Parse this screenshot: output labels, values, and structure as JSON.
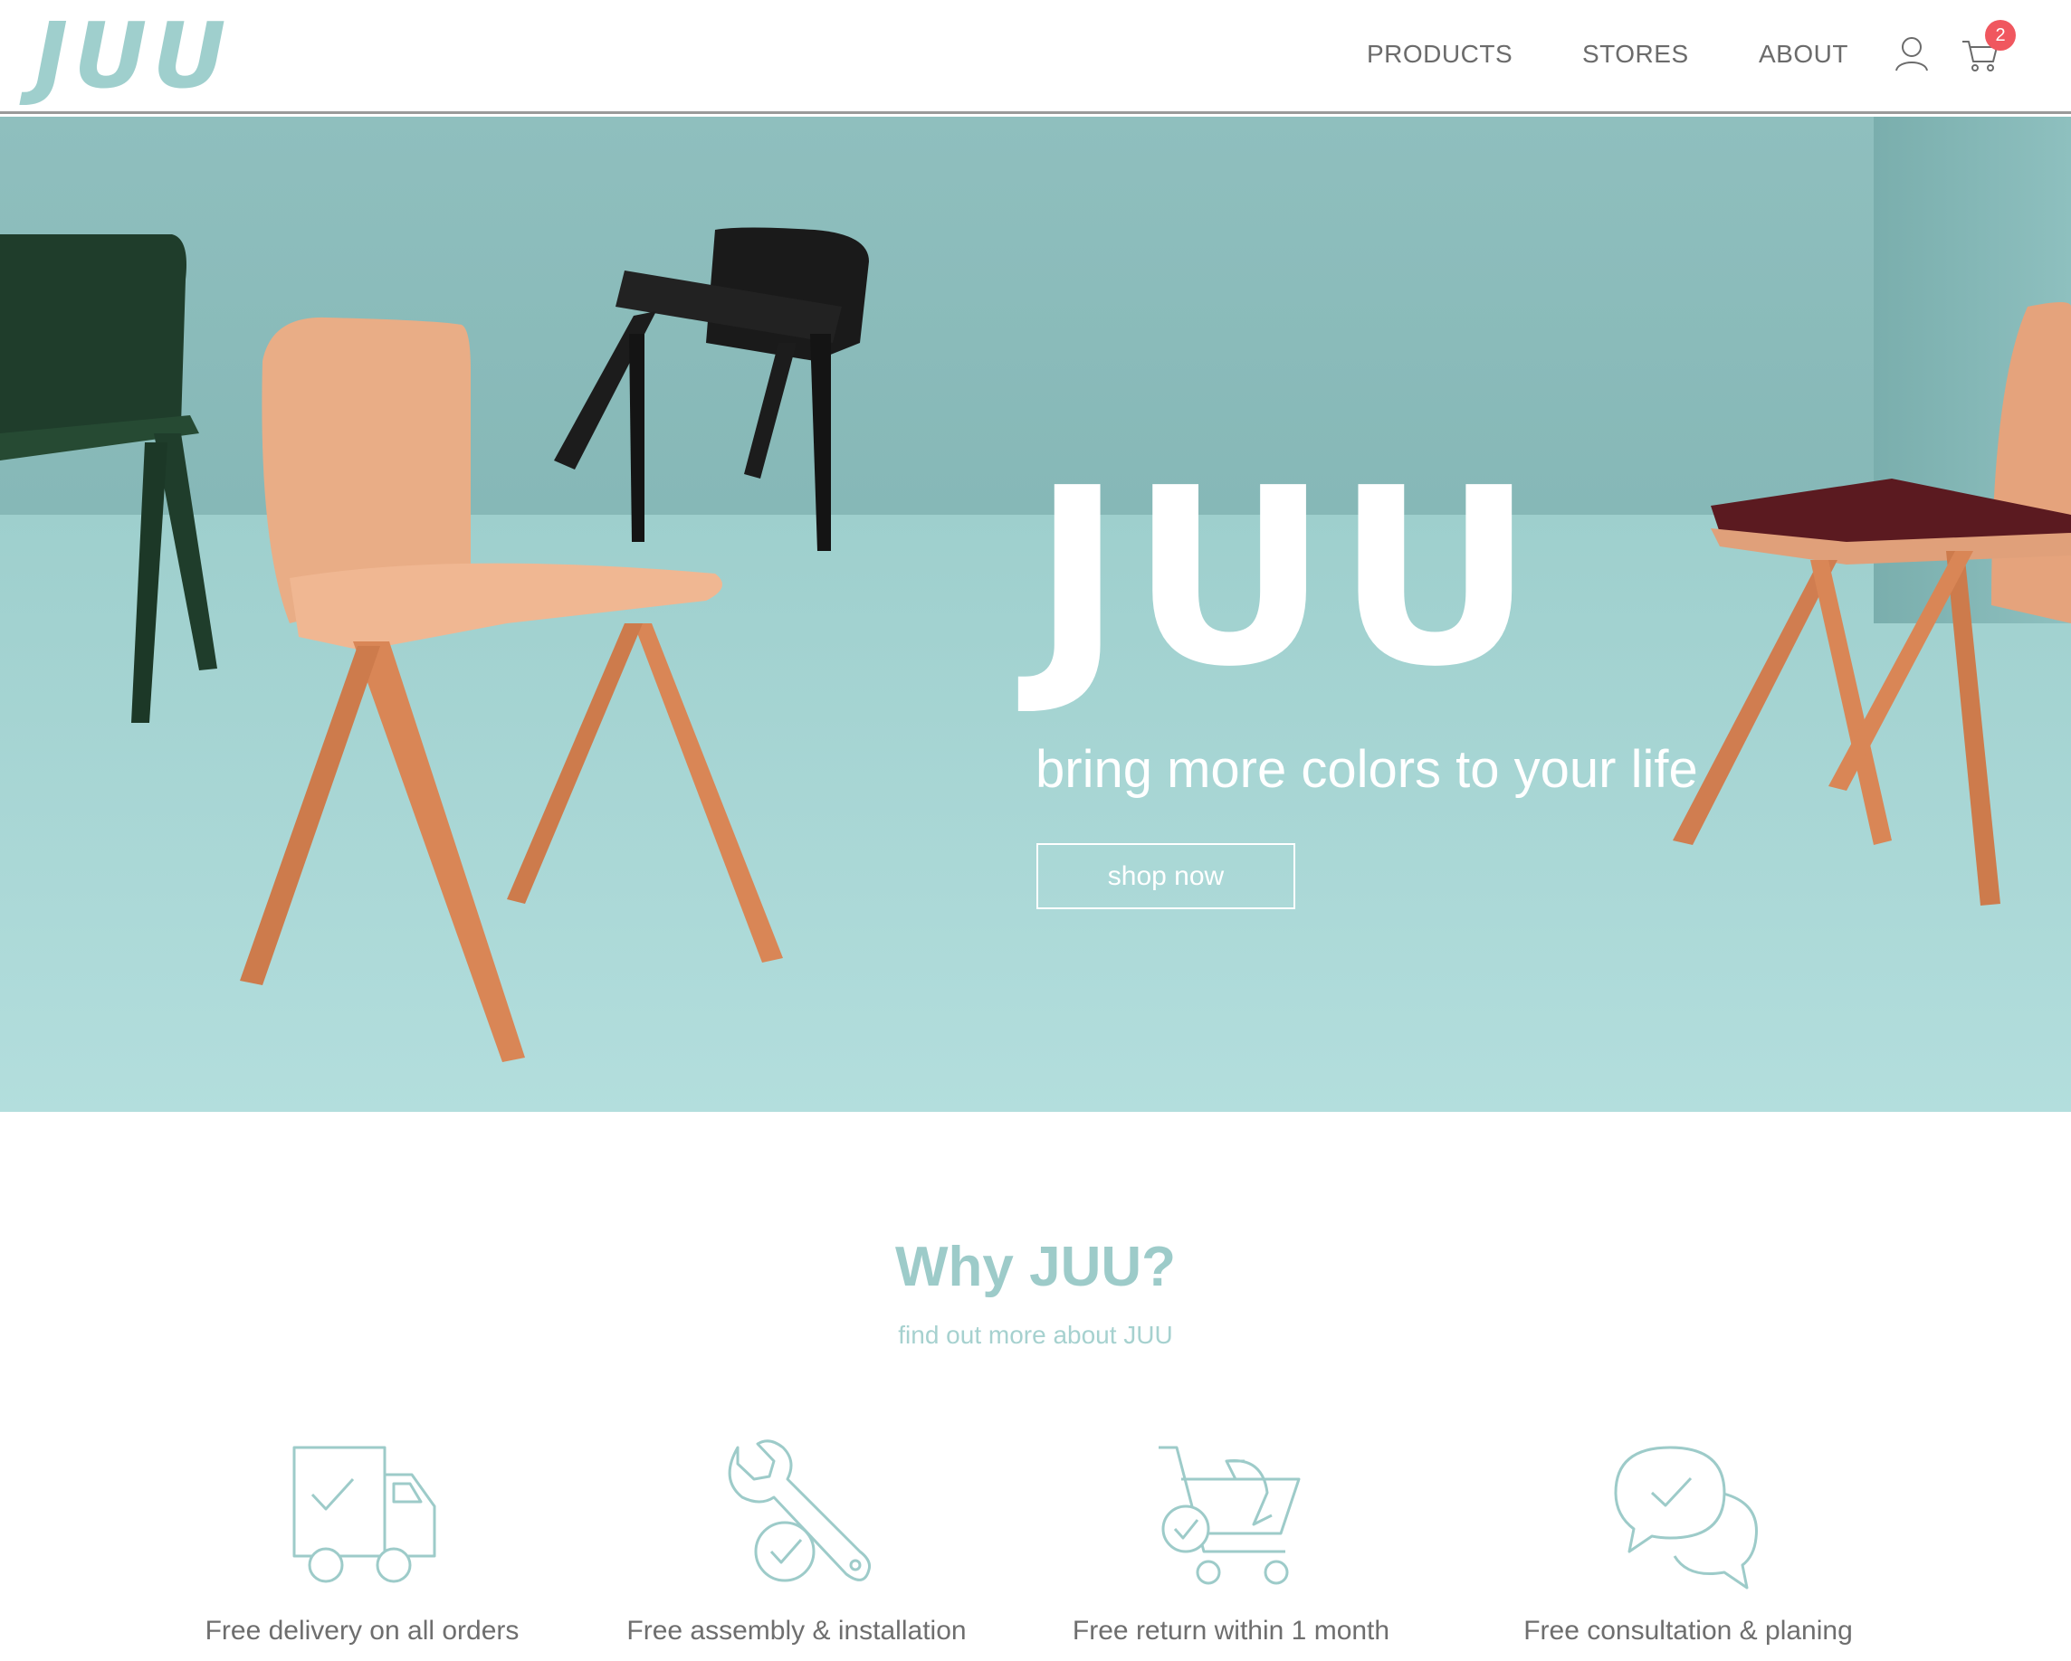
{
  "header": {
    "logo_text": "JUU",
    "nav": [
      {
        "label": "PRODUCTS"
      },
      {
        "label": "STORES"
      },
      {
        "label": "ABOUT"
      }
    ],
    "user_icon": "user-icon",
    "cart_icon": "cart-icon",
    "cart_count": "2"
  },
  "hero": {
    "title": "JUU",
    "subtitle": "bring more colors to your life",
    "cta_label": "shop now"
  },
  "why": {
    "title": "Why JUU?",
    "subtitle": "find out more about JUU",
    "features": [
      {
        "icon": "delivery-truck-icon",
        "label": "Free delivery on all orders"
      },
      {
        "icon": "wrench-icon",
        "label": "Free assembly & installation"
      },
      {
        "icon": "cart-return-icon",
        "label": "Free return within 1 month"
      },
      {
        "icon": "chat-bubbles-icon",
        "label": "Free consultation & planing"
      }
    ]
  },
  "colors": {
    "accent": "#9dcbc9",
    "badge": "#f0575f",
    "hero_bg": "#9ecfcd"
  }
}
